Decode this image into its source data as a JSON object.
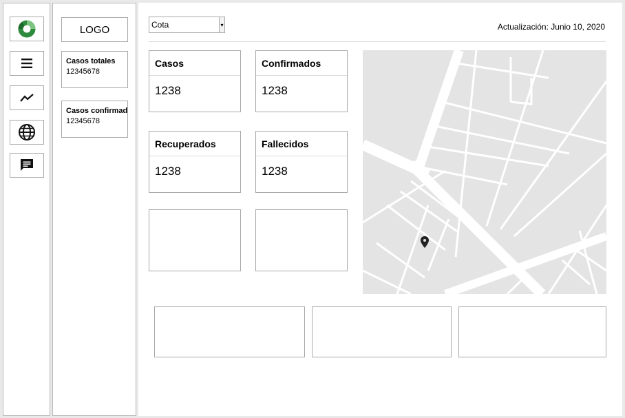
{
  "nav": {
    "items": [
      {
        "icon": "donut-chart-icon",
        "color": "#2e8b3d"
      },
      {
        "icon": "menu-icon"
      },
      {
        "icon": "trend-line-icon"
      },
      {
        "icon": "globe-icon"
      },
      {
        "icon": "chat-icon"
      }
    ]
  },
  "sidebar": {
    "logo": "LOGO",
    "cards": [
      {
        "title": "Casos totales",
        "value": "12345678"
      },
      {
        "title": "Casos confirmados",
        "value": "12345678"
      }
    ]
  },
  "header": {
    "select_value": "Cota",
    "updated": "Actualización: Junio 10, 2020"
  },
  "stats": [
    {
      "label": "Casos",
      "value": "1238"
    },
    {
      "label": "Confirmados",
      "value": "1238"
    },
    {
      "label": "Recuperados",
      "value": "1238"
    },
    {
      "label": "Fallecidos",
      "value": "1238"
    }
  ],
  "map": {
    "marker_icon": "map-pin-icon"
  }
}
